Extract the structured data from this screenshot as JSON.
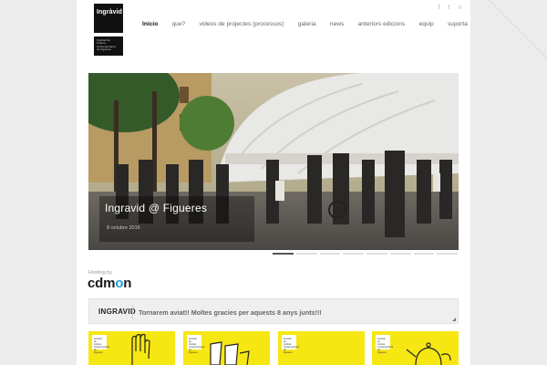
{
  "brand": {
    "name": "Ingràvid",
    "subtitle": "Festival de\nCultura\nContemporània\nde Figueres"
  },
  "social": [
    "f",
    "t",
    "v"
  ],
  "nav": {
    "items": [
      {
        "label": "Inicio",
        "active": true
      },
      {
        "label": "que?"
      },
      {
        "label": "videos de projectes (processos)"
      },
      {
        "label": "galeria"
      },
      {
        "label": "news"
      },
      {
        "label": "anteriors edicions"
      },
      {
        "label": "equip"
      },
      {
        "label": "suporta"
      }
    ]
  },
  "slider": {
    "title": "Ingravid @ Figueres",
    "date": "8 octubre 2016",
    "slides": 8,
    "active_slide": 1
  },
  "sponsor": {
    "label": "Hosting by",
    "logo_a": "cd",
    "logo_b": "m",
    "logo_c": "o",
    "logo_d": "n"
  },
  "ticker": {
    "brand": "INGRAVID",
    "message": "Tornarem aviat!! Moltes gracies per aquests 8 anys junts!!!"
  },
  "cards": [
    {
      "tag": "Festival de\nCultura\nContemporània\nde Figueres",
      "icon": "hand-icon"
    },
    {
      "tag": "Festival de\nCultura\nContemporània\nde Figueres",
      "icon": "glasses-icon"
    },
    {
      "tag": "Festival de\nCultura\nContemporània\nde Figueres",
      "icon": "blank"
    },
    {
      "tag": "Festival de\nCultura\nContemporània\nde Figueres",
      "icon": "teapot-icon"
    }
  ],
  "colors": {
    "card_yellow": "#f6e713",
    "cdmon_blue": "#1c9fd9",
    "page_bg": "#ececec"
  }
}
